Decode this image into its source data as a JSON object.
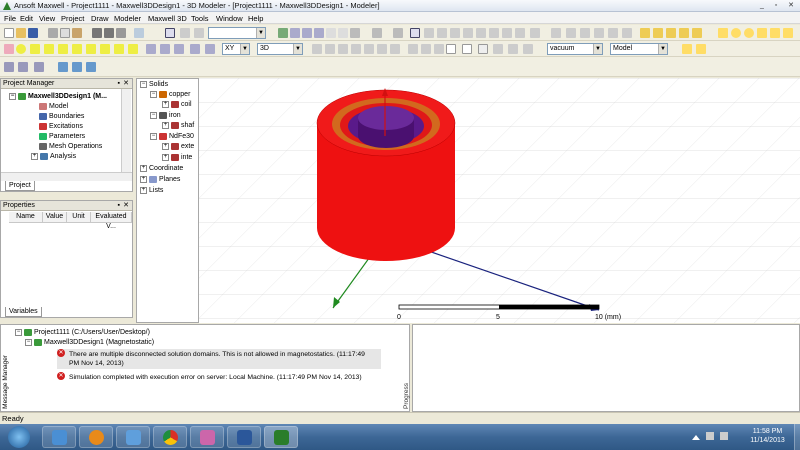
{
  "window": {
    "title": "Ansoft Maxwell  - Project1111 - Maxwell3DDesign1 - 3D Modeler - [Project1111 - Maxwell3DDesign1 - Modeler]",
    "minimize": "_",
    "restore": "▫",
    "close": "✕"
  },
  "menu": [
    "File",
    "Edit",
    "View",
    "Project",
    "Draw",
    "Modeler",
    "Maxwell 3D",
    "Tools",
    "Window",
    "Help"
  ],
  "toolbar": {
    "plane_value": "XY",
    "view_mode_value": "3D",
    "material_value": "vacuum",
    "model_value": "Model"
  },
  "project_manager": {
    "title": "Project Manager",
    "design": "Maxwell3DDesign1 (M...",
    "items": [
      "Model",
      "Boundaries",
      "Excitations",
      "Parameters",
      "Mesh Operations",
      "Analysis"
    ],
    "tab": "Project"
  },
  "properties": {
    "title": "Properties",
    "columns": [
      "Name",
      "Value",
      "Unit",
      "Evaluated V..."
    ],
    "tab": "Variables"
  },
  "model_tree": {
    "items": [
      {
        "label": "Solids"
      },
      {
        "label": "copper"
      },
      {
        "label": "coil"
      },
      {
        "label": "iron"
      },
      {
        "label": "shaf"
      },
      {
        "label": "NdFe30"
      },
      {
        "label": "exte"
      },
      {
        "label": "inte"
      },
      {
        "label": "Coordinate"
      },
      {
        "label": "Planes"
      },
      {
        "label": "Lists"
      }
    ]
  },
  "viewport": {
    "scale_labels": [
      "0",
      "5",
      "10 (mm)"
    ]
  },
  "messages": {
    "panel_label": "Message Manager",
    "project": "Project1111 (C:/Users/User/Desktop/)",
    "design": "Maxwell3DDesign1 (Magnetostatic)",
    "entries": [
      {
        "text": "There are multiple disconnected solution domains. This is not allowed in magnetostatics. (11:17:49 PM  Nov 14, 2013)",
        "icon": "error-icon"
      },
      {
        "text": "Simulation completed with execution error on server: Local Machine. (11:17:49 PM  Nov 14, 2013)",
        "icon": "error-icon"
      }
    ]
  },
  "progress": {
    "label": "Progress"
  },
  "status": {
    "text": "Ready"
  },
  "taskbar": {
    "time": "11:58 PM",
    "date": "11/14/2013",
    "apps": [
      "windows-explorer-icon",
      "media-player-icon",
      "devices-icon",
      "chrome-icon",
      "app-icon",
      "word-icon",
      "maxwell-icon"
    ]
  },
  "colors": {
    "outer_magnet": "#ee1111",
    "copper_ring": "#d2691e",
    "core": "#5a1a8a",
    "x_axis": "#1a237e",
    "y_axis": "#1f8a1f",
    "z_axis": "#d11111"
  }
}
